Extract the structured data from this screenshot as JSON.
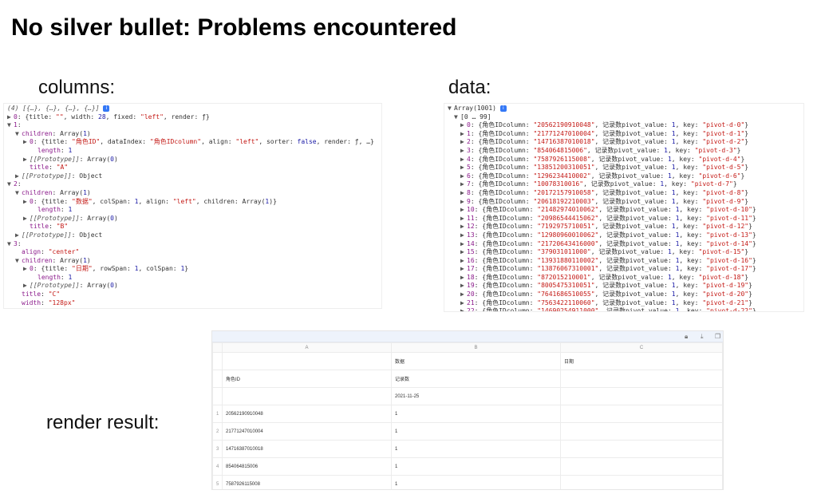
{
  "slide": {
    "title": "No silver bullet: Problems encountered",
    "columns_label": "columns:",
    "data_label": "data:",
    "render_label": "render result:"
  },
  "columns_console": {
    "lines": [
      {
        "indent": 0,
        "text": "(4) [{…}, {…}, {…}, {…}]",
        "cls": "it",
        "info": true
      },
      {
        "indent": 0,
        "tri": "▶",
        "key": "0",
        "rest": ": {title: \"\", width: 28, fixed: \"left\", render: ƒ}"
      },
      {
        "indent": 0,
        "tri": "▼",
        "key": "1",
        "rest": ":"
      },
      {
        "indent": 1,
        "tri": "▼",
        "key": "children",
        "rest": ": Array(1)"
      },
      {
        "indent": 2,
        "tri": "▶",
        "key": "0",
        "rest": ": {title: \"角色ID\", dataIndex: \"角色IDcolumn\", align: \"left\", sorter: false, render: ƒ, …}"
      },
      {
        "indent": 3,
        "key": "length",
        "rest": ": 1"
      },
      {
        "indent": 2,
        "tri": "▶",
        "key": "[[Prototype]]",
        "rest": ": Array(0)",
        "italic": true
      },
      {
        "indent": 2,
        "key": "title",
        "rest": ": \"A\""
      },
      {
        "indent": 1,
        "tri": "▶",
        "key": "[[Prototype]]",
        "rest": ": Object",
        "italic": true
      },
      {
        "indent": 0,
        "tri": "▼",
        "key": "2",
        "rest": ":"
      },
      {
        "indent": 1,
        "tri": "▼",
        "key": "children",
        "rest": ": Array(1)"
      },
      {
        "indent": 2,
        "tri": "▶",
        "key": "0",
        "rest": ": {title: \"数据\", colSpan: 1, align: \"left\", children: Array(1)}"
      },
      {
        "indent": 3,
        "key": "length",
        "rest": ": 1"
      },
      {
        "indent": 2,
        "tri": "▶",
        "key": "[[Prototype]]",
        "rest": ": Array(0)",
        "italic": true
      },
      {
        "indent": 2,
        "key": "title",
        "rest": ": \"B\""
      },
      {
        "indent": 1,
        "tri": "▶",
        "key": "[[Prototype]]",
        "rest": ": Object",
        "italic": true
      },
      {
        "indent": 0,
        "tri": "▼",
        "key": "3",
        "rest": ":"
      },
      {
        "indent": 1,
        "key": "align",
        "rest": ": \"center\""
      },
      {
        "indent": 1,
        "tri": "▼",
        "key": "children",
        "rest": ": Array(1)"
      },
      {
        "indent": 2,
        "tri": "▶",
        "key": "0",
        "rest": ": {title: \"日期\", rowSpan: 1, colSpan: 1}"
      },
      {
        "indent": 3,
        "key": "length",
        "rest": ": 1"
      },
      {
        "indent": 2,
        "tri": "▶",
        "key": "[[Prototype]]",
        "rest": ": Array(0)",
        "italic": true
      },
      {
        "indent": 1,
        "key": "title",
        "rest": ": \"C\""
      },
      {
        "indent": 1,
        "key": "width",
        "rest": ": \"128px\""
      }
    ]
  },
  "data_console": {
    "header": "Array(1001)",
    "range": "[0 … 99]",
    "rows": [
      {
        "i": "0",
        "id": "20562190910048",
        "key": "pivot-d-0"
      },
      {
        "i": "1",
        "id": "21771247010004",
        "key": "pivot-d-1"
      },
      {
        "i": "2",
        "id": "14716387010018",
        "key": "pivot-d-2"
      },
      {
        "i": "3",
        "id": "854064815006",
        "key": "pivot-d-3"
      },
      {
        "i": "4",
        "id": "7587926115008",
        "key": "pivot-d-4"
      },
      {
        "i": "5",
        "id": "13851200310051",
        "key": "pivot-d-5"
      },
      {
        "i": "6",
        "id": "1296234410002",
        "key": "pivot-d-6"
      },
      {
        "i": "7",
        "id": "10078310016",
        "key": "pivot-d-7"
      },
      {
        "i": "8",
        "id": "20172157910058",
        "key": "pivot-d-8"
      },
      {
        "i": "9",
        "id": "20618192210003",
        "key": "pivot-d-9"
      },
      {
        "i": "10",
        "id": "21482974010062",
        "key": "pivot-d-10"
      },
      {
        "i": "11",
        "id": "20986544415062",
        "key": "pivot-d-11"
      },
      {
        "i": "12",
        "id": "7192975710051",
        "key": "pivot-d-12"
      },
      {
        "i": "13",
        "id": "12980960010062",
        "key": "pivot-d-13"
      },
      {
        "i": "14",
        "id": "21720643416000",
        "key": "pivot-d-14"
      },
      {
        "i": "15",
        "id": "379031011000",
        "key": "pivot-d-15"
      },
      {
        "i": "16",
        "id": "13931880110002",
        "key": "pivot-d-16"
      },
      {
        "i": "17",
        "id": "13876067310001",
        "key": "pivot-d-17"
      },
      {
        "i": "18",
        "id": "872015210001",
        "key": "pivot-d-18"
      },
      {
        "i": "19",
        "id": "8005475310051",
        "key": "pivot-d-19"
      },
      {
        "i": "20",
        "id": "7641686510055",
        "key": "pivot-d-20"
      },
      {
        "i": "21",
        "id": "7563422110060",
        "key": "pivot-d-21"
      },
      {
        "i": "22",
        "id": "14690254911000",
        "key": "pivot-d-22"
      }
    ],
    "field_id": "角色IDcolumn",
    "field_pivot": "记录数pivot_value",
    "pivot_value": "1",
    "field_key": "key"
  },
  "render_grid": {
    "col_headers": [
      "A",
      "B",
      "C"
    ],
    "header_rows": [
      [
        "",
        "数据",
        "日期"
      ],
      [
        "角色ID",
        "记录数",
        ""
      ],
      [
        "",
        "2021-11-25",
        ""
      ]
    ],
    "rows": [
      {
        "num": "1",
        "id": "20562190910048",
        "val": "1"
      },
      {
        "num": "2",
        "id": "21771247010004",
        "val": "1"
      },
      {
        "num": "3",
        "id": "14716387010018",
        "val": "1"
      },
      {
        "num": "4",
        "id": "854064815006",
        "val": "1"
      },
      {
        "num": "5",
        "id": "7587926115008",
        "val": "1"
      }
    ],
    "toolbar_icons": [
      "lock-icon",
      "download-icon",
      "copy-icon"
    ]
  }
}
